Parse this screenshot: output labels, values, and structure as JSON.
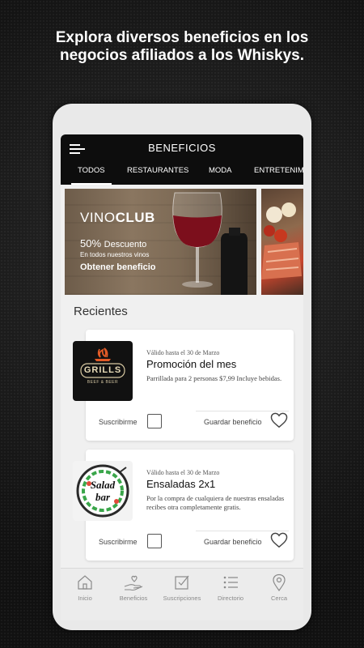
{
  "headline": {
    "line1": "Explora diversos beneficios en los",
    "line2": "negocios afiliados a los Whiskys."
  },
  "app": {
    "title": "BENEFICIOS",
    "tabs": [
      {
        "label": "TODOS",
        "active": true
      },
      {
        "label": "RESTAURANTES",
        "active": false
      },
      {
        "label": "MODA",
        "active": false
      },
      {
        "label": "ENTRETENIM",
        "active": false
      }
    ]
  },
  "banner": {
    "logo_light": "VINO",
    "logo_bold": "CLUB",
    "discount_value": "50%",
    "discount_word": "Descuento",
    "discount_sub": "En todos nuestros vinos",
    "cta": "Obtener beneficio"
  },
  "recientes": {
    "title": "Recientes",
    "cards": [
      {
        "logo": "grills-logo",
        "logo_text": "GRILLS",
        "logo_subtext": "BEEF & BEER",
        "valid": "Válido hasta el 30 de Marzo",
        "title": "Promoción del mes",
        "desc": "Parrillada para 2 personas $7,99 Incluye bebidas.",
        "subscribe": "Suscribirme",
        "save": "Guardar beneficio"
      },
      {
        "logo": "salad-bar-logo",
        "logo_text1": "Salad",
        "logo_text2": "bar",
        "valid": "Válido hasta el 30 de Marzo",
        "title": "Ensaladas 2x1",
        "desc": "Por la compra de cualquiera de nuestras ensaladas recibes otra completamente gratis.",
        "subscribe": "Suscribirme",
        "save": "Guardar beneficio"
      }
    ]
  },
  "bottom_nav": [
    {
      "label": "Inicio",
      "icon": "home-icon"
    },
    {
      "label": "Beneficios",
      "icon": "gift-hand-icon"
    },
    {
      "label": "Suscripciones",
      "icon": "checkbox-icon"
    },
    {
      "label": "Directorio",
      "icon": "list-icon"
    },
    {
      "label": "Cerca",
      "icon": "location-pin-icon"
    }
  ],
  "colors": {
    "background": "#1b1b1b",
    "topbar": "#0d0d0d",
    "heart": "#444444",
    "grills_accent": "#e25b27",
    "salad_green": "#3aa64a"
  }
}
